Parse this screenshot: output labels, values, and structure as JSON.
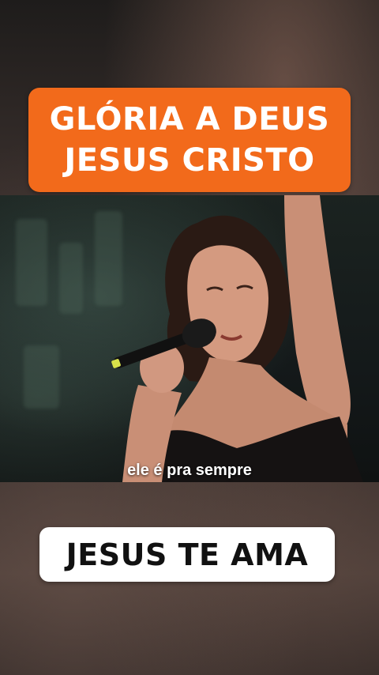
{
  "top_banner": {
    "line1": "GLÓRIA A DEUS",
    "line2": "JESUS CRISTO"
  },
  "video": {
    "subtitle": "ele é pra sempre"
  },
  "bottom_banner": {
    "text": "JESUS TE AMA"
  },
  "colors": {
    "banner_orange": "#f26a1b",
    "banner_white": "#ffffff",
    "text_dark": "#111111"
  }
}
